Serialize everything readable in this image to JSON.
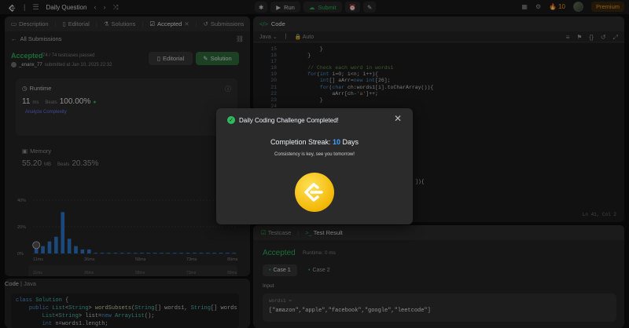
{
  "topbar": {
    "title": "Daily Question",
    "run_label": "Run",
    "submit_label": "Submit",
    "streak_count": "10",
    "premium_label": "Premium"
  },
  "left_tabs": [
    {
      "label": "Description"
    },
    {
      "label": "Editorial"
    },
    {
      "label": "Solutions"
    },
    {
      "label": "Accepted"
    },
    {
      "label": "Submissions"
    }
  ],
  "submission": {
    "back_label": "All Submissions",
    "status": "Accepted",
    "passed": "74 / 74 testcases passed",
    "user": "_enanx_77",
    "submitted_at": "submitted at Jan 10, 2025 22:32",
    "editorial_btn": "Editorial",
    "solution_btn": "Solution"
  },
  "runtime": {
    "label": "Runtime",
    "value": "11",
    "unit": "ms",
    "beats_label": "Beats",
    "beats_pct": "100.00%",
    "analyze_label": "Analyze Complexity"
  },
  "memory": {
    "label": "Memory",
    "value": "55.20",
    "unit": "MB",
    "beats_label": "Beats",
    "beats_pct": "20.35%"
  },
  "chart_data": {
    "type": "bar",
    "ytick_labels": [
      "40%",
      "20%",
      "0%"
    ],
    "xtick_labels": [
      "11ms",
      "36ms",
      "58ms",
      "73ms",
      "89ms"
    ],
    "values": [
      4.5,
      5.5,
      9,
      12.5,
      31,
      11,
      5.5,
      3,
      3,
      0.5,
      0.5,
      0.5,
      0.5,
      0.5,
      0.5,
      0.5,
      0.5,
      0.5,
      0.5,
      0.5,
      0.5,
      0.5,
      0.5,
      0.5,
      0.5,
      0.5,
      0.5,
      0.5,
      0.5,
      0.5,
      0.5
    ],
    "ylim": [
      0,
      50
    ],
    "highlight_index": 0,
    "brush_labels": [
      "11ms",
      "36ms",
      "58ms",
      "73ms",
      "89ms"
    ]
  },
  "left_code": {
    "header": "Code",
    "lang": "Java"
  },
  "right_code": {
    "title": "Code",
    "lang": "Java",
    "auto": "Auto",
    "cursor": "Ln 41, Col 2",
    "line_numbers": [
      "15",
      "16",
      "17",
      "18",
      "19",
      "20",
      "21",
      "22",
      "23",
      "24",
      "25",
      "26",
      "27",
      "28",
      "29",
      "30",
      "31",
      "32",
      "33",
      "34",
      "35",
      "36",
      "37",
      "38",
      "39",
      "40",
      "41"
    ],
    "partial_text": "]){"
  },
  "test": {
    "tab_testcase": "Testcase",
    "tab_result": "Test Result",
    "status": "Accepted",
    "runtime": "Runtime: 0 ms",
    "case1": "Case 1",
    "case2": "Case 2",
    "input_label": "Input",
    "var_name": "words1 =",
    "value": "[\"amazon\",\"apple\",\"facebook\",\"google\",\"leetcode\"]"
  },
  "modal": {
    "title": "Daily Coding Challenge Completed!",
    "streak_label": "Completion Streak:",
    "streak_num": "10",
    "streak_unit": "Days",
    "subtitle": "Consistency is key, see you tomorrow!"
  }
}
